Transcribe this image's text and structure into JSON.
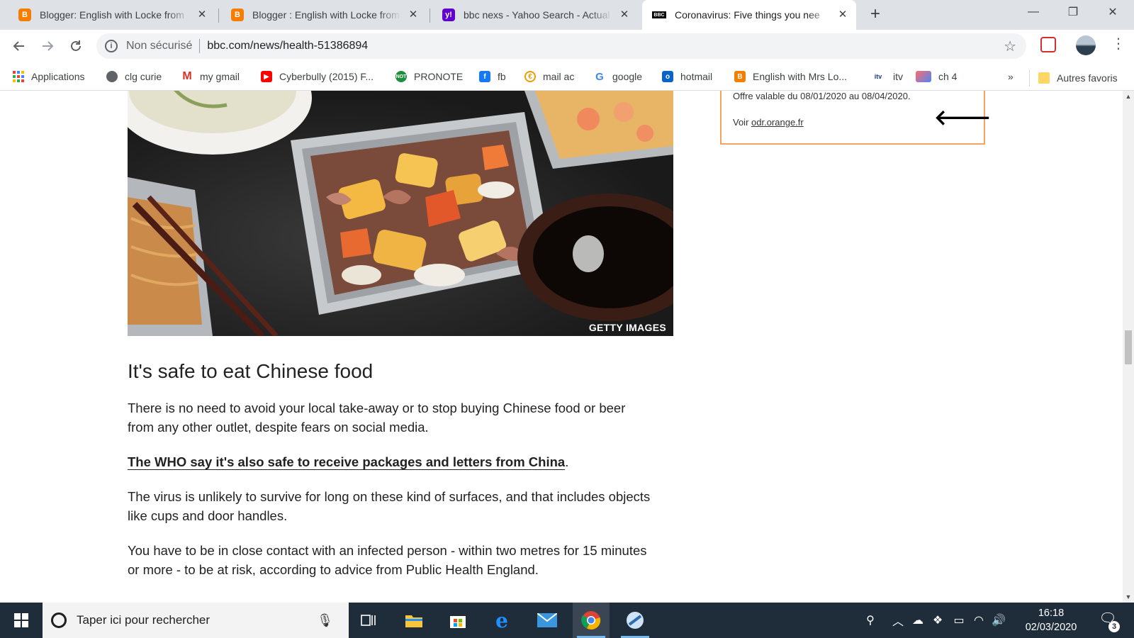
{
  "browser": {
    "tabs": [
      {
        "title": "Blogger: English with Locke from",
        "favicon": "blogger-icon",
        "color": "#f57d00"
      },
      {
        "title": "Blogger : English with Locke from",
        "favicon": "blogger-icon",
        "color": "#f57d00"
      },
      {
        "title": "bbc nexs - Yahoo Search - Actual",
        "favicon": "yahoo-icon",
        "color": "#6001d2"
      },
      {
        "title": "Coronavirus: Five things you nee",
        "favicon": "bbc-icon",
        "color": "#000000"
      }
    ],
    "active_tab": 3,
    "security_label": "Non sécurisé",
    "url": "bbc.com/news/health-51386894"
  },
  "bookmarks": [
    {
      "label": "Applications",
      "icon": "apps-grid-icon"
    },
    {
      "label": "clg curie",
      "icon": "globe-icon"
    },
    {
      "label": "my gmail",
      "icon": "gmail-icon"
    },
    {
      "label": "Cyberbully (2015) F...",
      "icon": "youtube-icon"
    },
    {
      "label": "PRONOTE",
      "icon": "pronote-icon"
    },
    {
      "label": "fb",
      "icon": "facebook-icon"
    },
    {
      "label": "mail ac",
      "icon": "mail-ac-icon"
    },
    {
      "label": "google",
      "icon": "google-icon"
    },
    {
      "label": "hotmail",
      "icon": "outlook-icon"
    },
    {
      "label": "English with Mrs Lo...",
      "icon": "blogger-icon"
    },
    {
      "label": "itv",
      "icon": "itv-icon"
    },
    {
      "label": "ch 4",
      "icon": "channel4-icon"
    }
  ],
  "bookmarks_overflow": "»",
  "other_bookmarks": "Autres favoris",
  "ad": {
    "line1": "Offre valable du 08/01/2020 au 08/04/2020.",
    "line2_prefix": "Voir ",
    "link": "odr.orange.fr"
  },
  "image_credit": "GETTY IMAGES",
  "article": {
    "heading": "It's safe to eat Chinese food",
    "p1": "There is no need to avoid your local take-away or to stop buying Chinese food or beer from any other outlet, despite fears on social media.",
    "p2_link": "The WHO say it's also safe to receive packages and letters from China",
    "p2_end": ".",
    "p3": "The virus is unlikely to survive for long on these kind of surfaces, and that includes objects like cups and door handles.",
    "p4": "You have to be in close contact with an infected person - within two metres for 15 minutes or more - to be at risk, according to advice from Public Health England."
  },
  "taskbar": {
    "search_placeholder": "Taper ici pour rechercher",
    "time": "16:18",
    "date": "02/03/2020",
    "notification_count": "3"
  }
}
